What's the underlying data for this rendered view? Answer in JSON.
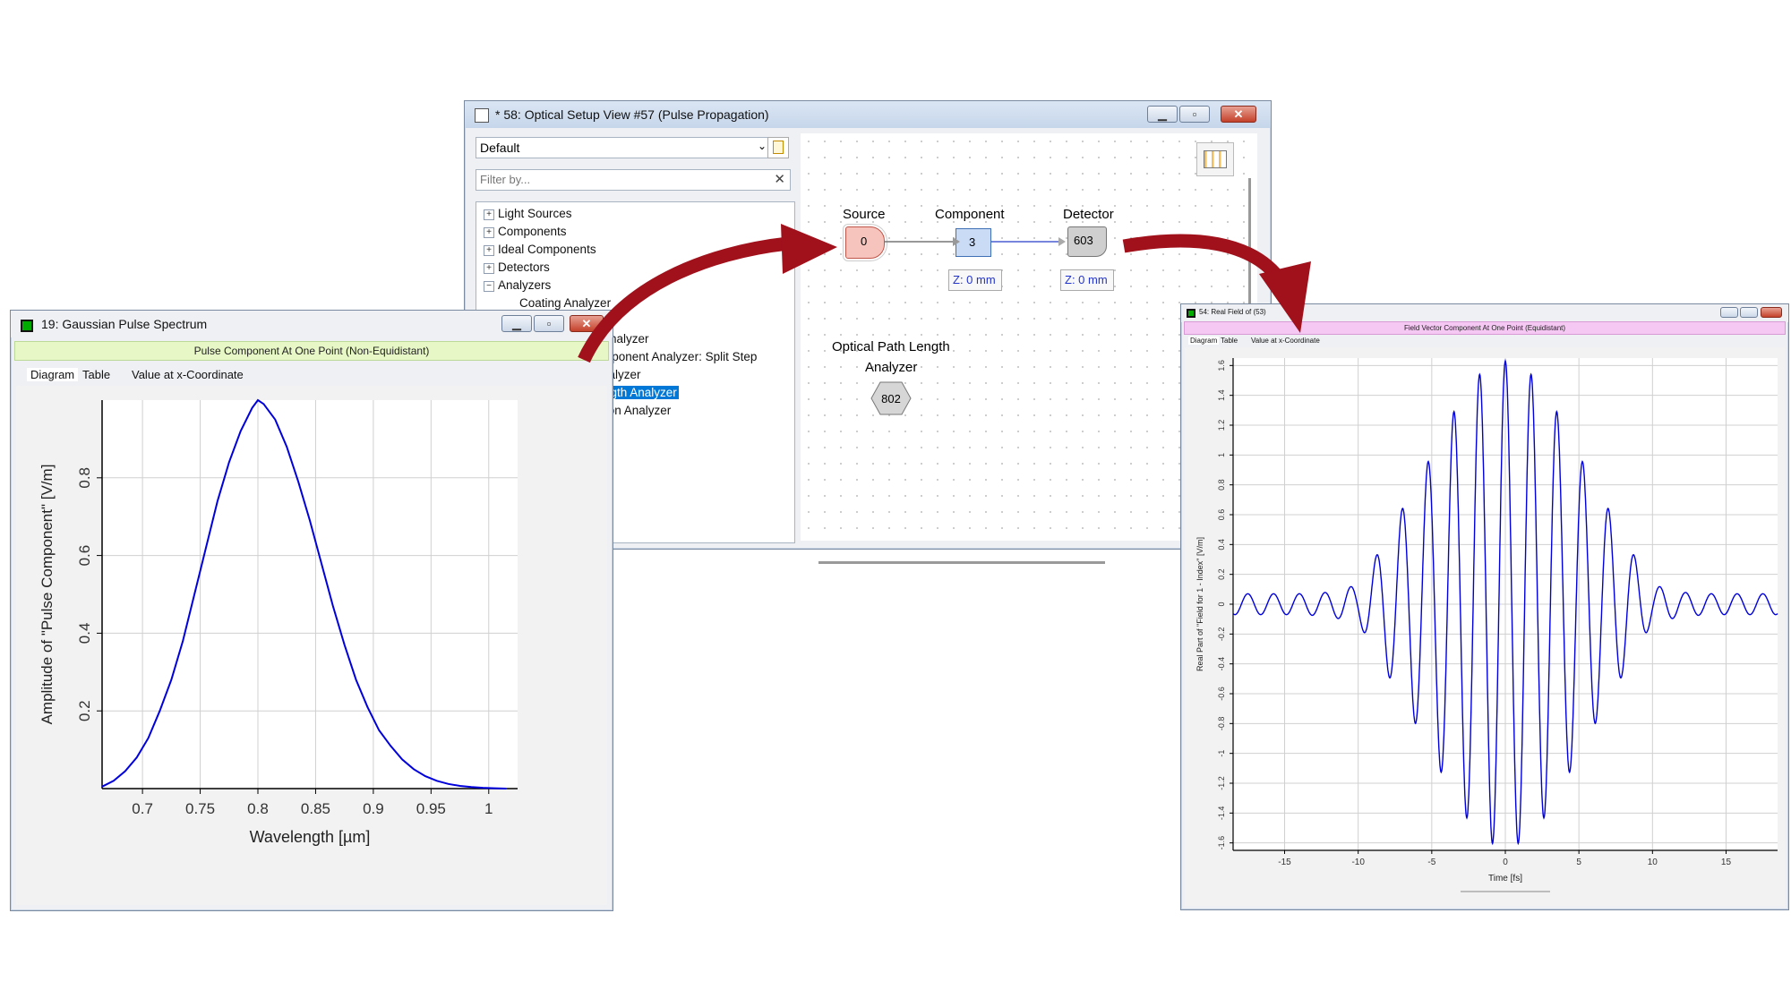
{
  "colors": {
    "arrow": "#a0111c",
    "curve": "#0000dd",
    "plot_band_left": "#e7f8c6",
    "plot_band_right": "#f5c8f3",
    "selection": "#0078d7",
    "source_fill": "#f7c4bd",
    "component_fill": "#c9dbf5",
    "detector_fill": "#cfcfcf"
  },
  "setup_window": {
    "title": "* 58: Optical Setup View #57 (Pulse Propagation)",
    "title_icon": "setup-view-icon",
    "preset": "Default",
    "filter_placeholder": "Filter by...",
    "tree": [
      {
        "label": "Light Sources",
        "expander": "+"
      },
      {
        "label": "Components",
        "expander": "+"
      },
      {
        "label": "Ideal Components",
        "expander": "+"
      },
      {
        "label": "Detectors",
        "expander": "+"
      },
      {
        "label": "Analyzers",
        "expander": "−"
      },
      {
        "label": "Coating Analyzer",
        "expander": ""
      },
      {
        "label": "Analyzer",
        "expander": ""
      },
      {
        "label": "mponent Analyzer: Split Step",
        "expander": ""
      },
      {
        "label": "nalyzer",
        "expander": ""
      },
      {
        "label": "ngth Analyzer",
        "expander": "",
        "selected": true
      },
      {
        "label": "tion Analyzer",
        "expander": ""
      }
    ],
    "canvas": {
      "source": {
        "label": "Source",
        "id": "0"
      },
      "component": {
        "label": "Component",
        "id": "3",
        "z": "Z: 0 mm"
      },
      "detector": {
        "label": "Detector",
        "id": "603",
        "z": "Z: 0 mm"
      },
      "analyzer": {
        "label_line1": "Optical Path Length",
        "label_line2": "Analyzer",
        "id": "802"
      }
    }
  },
  "spectrum_window": {
    "title": "19: Gaussian Pulse Spectrum",
    "band": "Pulse Component At One Point (Non-Equidistant)",
    "tabs": [
      "Diagram",
      "Table",
      "Value at x-Coordinate"
    ]
  },
  "field_window": {
    "title": "54: Real Field of (53)",
    "band": "Field Vector Component At One Point (Equidistant)",
    "tabs": [
      "Diagram",
      "Table",
      "Value at x-Coordinate"
    ]
  },
  "chart_data": [
    {
      "type": "line",
      "xlabel": "Wavelength [µm]",
      "ylabel": "Amplitude of \"Pulse Component\" [V/m]",
      "xlim": [
        0.665,
        1.025
      ],
      "ylim": [
        0,
        1.0
      ],
      "xticks": [
        "0.7",
        "0.75",
        "0.8",
        "0.85",
        "0.9",
        "0.95",
        "1"
      ],
      "yticks": [
        "0.2",
        "0.4",
        "0.6",
        "0.8"
      ],
      "grid": true,
      "series": [
        {
          "x": [
            0.665,
            0.675,
            0.685,
            0.695,
            0.705,
            0.715,
            0.725,
            0.735,
            0.745,
            0.755,
            0.765,
            0.775,
            0.785,
            0.795,
            0.8,
            0.805,
            0.815,
            0.825,
            0.835,
            0.845,
            0.855,
            0.865,
            0.875,
            0.885,
            0.895,
            0.905,
            0.915,
            0.925,
            0.935,
            0.945,
            0.955,
            0.965,
            0.975,
            0.985,
            0.995,
            1.005,
            1.015
          ],
          "y": [
            0.005,
            0.02,
            0.045,
            0.08,
            0.13,
            0.2,
            0.28,
            0.38,
            0.5,
            0.62,
            0.74,
            0.84,
            0.92,
            0.98,
            1.0,
            0.99,
            0.95,
            0.88,
            0.79,
            0.69,
            0.58,
            0.47,
            0.37,
            0.28,
            0.21,
            0.15,
            0.11,
            0.075,
            0.05,
            0.032,
            0.02,
            0.012,
            0.007,
            0.004,
            0.002,
            0.001,
            0.0
          ]
        }
      ]
    },
    {
      "type": "line",
      "xlabel": "Time [fs]",
      "ylabel": "Real Part of \"Field for 1 - Index\" [V/m]",
      "xlim": [
        -18.5,
        18.5
      ],
      "ylim": [
        -1.65,
        1.65
      ],
      "xticks": [
        "-15",
        "-10",
        "-5",
        "0",
        "5",
        "10",
        "15"
      ],
      "yticks": [
        "-1.6",
        "-1.4",
        "-1.2",
        "-1",
        "-0.8",
        "-0.6",
        "-0.4",
        "-0.2",
        "0",
        "0.2",
        "0.4",
        "0.6",
        "0.8",
        "1",
        "1.2",
        "1.4",
        "1.6"
      ],
      "grid": true,
      "series": [
        {
          "carrier_period_fs": 1.75,
          "envelope": {
            "t": [
              -18,
              -16,
              -14,
              -12,
              -10,
              -9,
              -8,
              -7,
              -6,
              -5,
              -4,
              -3,
              -2,
              -1,
              0,
              1,
              2,
              3,
              4,
              5,
              6,
              7,
              8,
              9,
              10,
              12,
              14,
              16,
              18
            ],
            "amplitude": [
              0.07,
              0.07,
              0.07,
              0.08,
              0.13,
              0.28,
              0.47,
              0.64,
              0.82,
              1.0,
              1.2,
              1.38,
              1.52,
              1.6,
              1.63,
              1.6,
              1.52,
              1.38,
              1.2,
              1.0,
              0.82,
              0.64,
              0.47,
              0.28,
              0.13,
              0.08,
              0.07,
              0.07,
              0.07
            ]
          }
        }
      ]
    }
  ]
}
